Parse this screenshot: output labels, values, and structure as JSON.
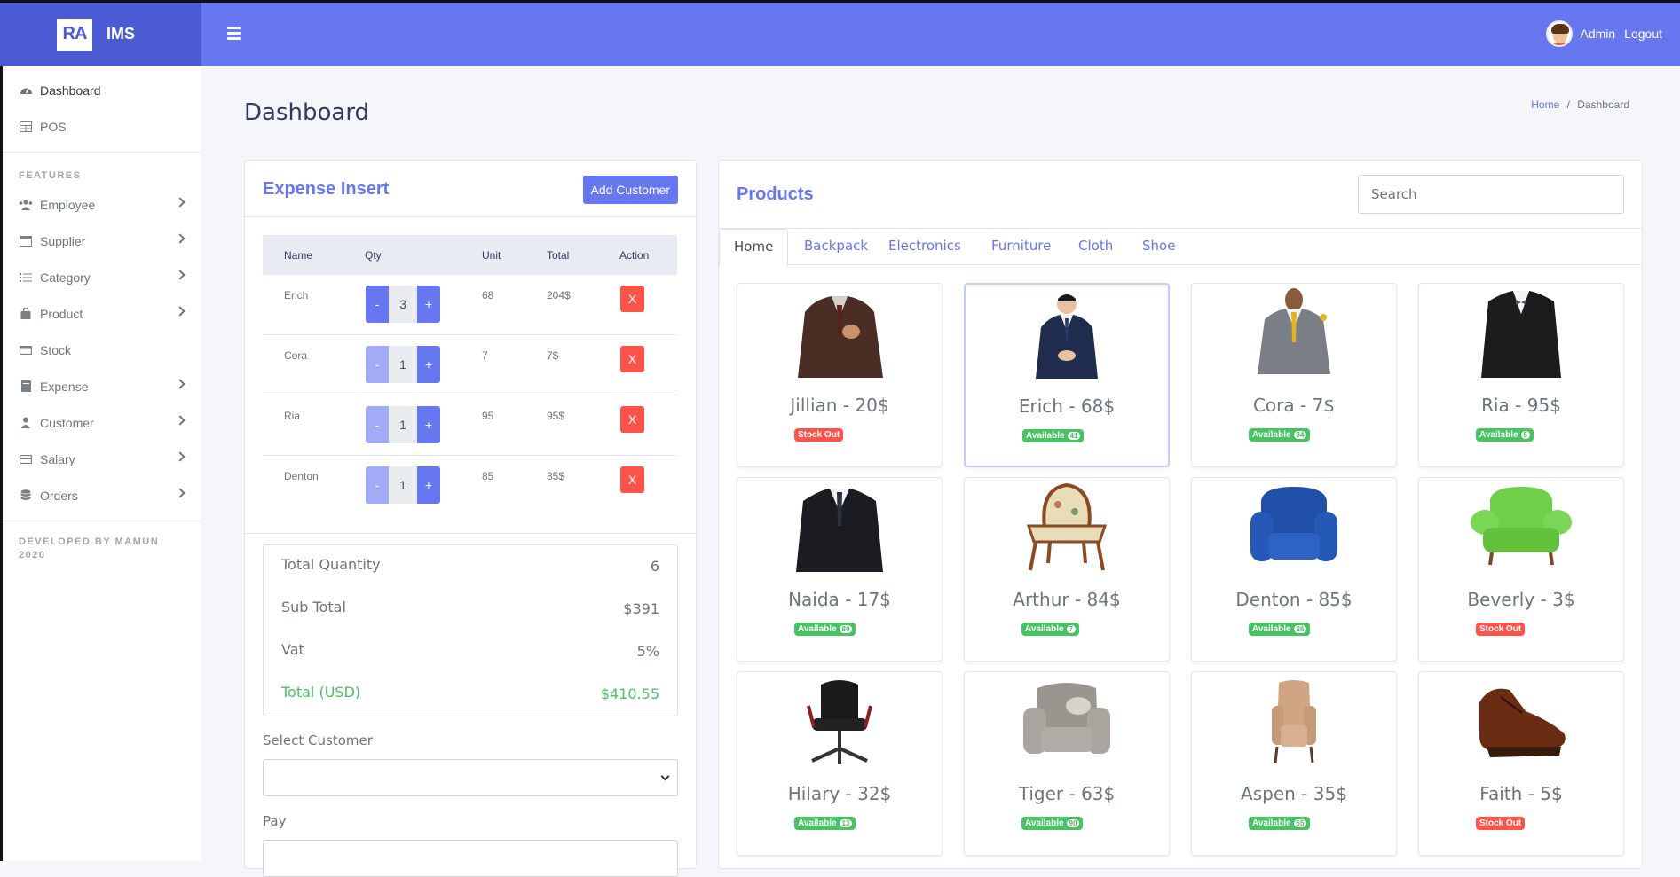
{
  "brand": {
    "logo": "RA",
    "name": "IMS"
  },
  "header": {
    "user": "Admin",
    "logout": "Logout"
  },
  "sidebar": {
    "top_items": [
      {
        "label": "Dashboard",
        "icon": "gauge-icon"
      },
      {
        "label": "POS",
        "icon": "table-icon"
      }
    ],
    "features_heading": "FEATURES",
    "feature_items": [
      {
        "label": "Employee",
        "icon": "users-icon"
      },
      {
        "label": "Supplier",
        "icon": "window-icon"
      },
      {
        "label": "Category",
        "icon": "list-icon"
      },
      {
        "label": "Product",
        "icon": "bag-icon"
      },
      {
        "label": "Stock",
        "icon": "box-icon"
      },
      {
        "label": "Expense",
        "icon": "book-icon"
      },
      {
        "label": "Customer",
        "icon": "user-icon"
      },
      {
        "label": "Salary",
        "icon": "card-icon"
      },
      {
        "label": "Orders",
        "icon": "database-icon"
      }
    ],
    "footer_line1": "DEVELOPED BY MAMUN",
    "footer_line2": "2020"
  },
  "page": {
    "title": "Dashboard",
    "breadcrumb_home": "Home",
    "breadcrumb_sep": "/",
    "breadcrumb_current": "Dashboard"
  },
  "expense": {
    "title": "Expense Insert",
    "add_button": "Add Customer",
    "columns": {
      "name": "Name",
      "qty": "Qty",
      "unit": "Unit",
      "total": "Total",
      "action": "Action"
    },
    "rows": [
      {
        "name": "Erich",
        "qty": "3",
        "unit": "68",
        "total": "204$"
      },
      {
        "name": "Cora",
        "qty": "1",
        "unit": "7",
        "total": "7$"
      },
      {
        "name": "Ria",
        "qty": "1",
        "unit": "95",
        "total": "95$"
      },
      {
        "name": "Denton",
        "qty": "1",
        "unit": "85",
        "total": "85$"
      }
    ],
    "minus": "-",
    "plus": "+",
    "delete": "X",
    "totals": {
      "quantity_label": "Total Quantity",
      "quantity": "6",
      "subtotal_label": "Sub Total",
      "subtotal": "$391",
      "vat_label": "Vat",
      "vat": "5%",
      "total_label": "Total (USD)",
      "total": "$410.55"
    },
    "select_customer_label": "Select Customer",
    "select_customer_value": "",
    "pay_label": "Pay"
  },
  "products": {
    "title": "Products",
    "search_placeholder": "Search",
    "tabs": [
      "Home",
      "Backpack",
      "Electronics",
      "Furniture",
      "Cloth",
      "Shoe"
    ],
    "active_tab": "Home",
    "items": [
      {
        "name": "Jillian - 20$",
        "status": "Stock Out",
        "count": "",
        "image": "brown-suit"
      },
      {
        "name": "Erich - 68$",
        "status": "Available",
        "count": "41",
        "image": "navy-suit"
      },
      {
        "name": "Cora - 7$",
        "status": "Available",
        "count": "34",
        "image": "grey-suit"
      },
      {
        "name": "Ria - 95$",
        "status": "Available",
        "count": "5",
        "image": "black-tux"
      },
      {
        "name": "Naida - 17$",
        "status": "Available",
        "count": "80",
        "image": "black-suit"
      },
      {
        "name": "Arthur - 84$",
        "status": "Available",
        "count": "7",
        "image": "antique-chair"
      },
      {
        "name": "Denton - 85$",
        "status": "Available",
        "count": "26",
        "image": "blue-armchair"
      },
      {
        "name": "Beverly - 3$",
        "status": "Stock Out",
        "count": "",
        "image": "green-armchair"
      },
      {
        "name": "Hilary - 32$",
        "status": "Available",
        "count": "13",
        "image": "office-chair"
      },
      {
        "name": "Tiger - 63$",
        "status": "Available",
        "count": "90",
        "image": "grey-armchair"
      },
      {
        "name": "Aspen - 35$",
        "status": "Available",
        "count": "65",
        "image": "beige-chair"
      },
      {
        "name": "Faith - 5$",
        "status": "Stock Out",
        "count": "",
        "image": "brown-shoe"
      }
    ]
  },
  "colors": {
    "accent": "#6777ef",
    "accent_dark": "#4a5bd4",
    "success": "#47c363",
    "danger": "#fc544b"
  }
}
